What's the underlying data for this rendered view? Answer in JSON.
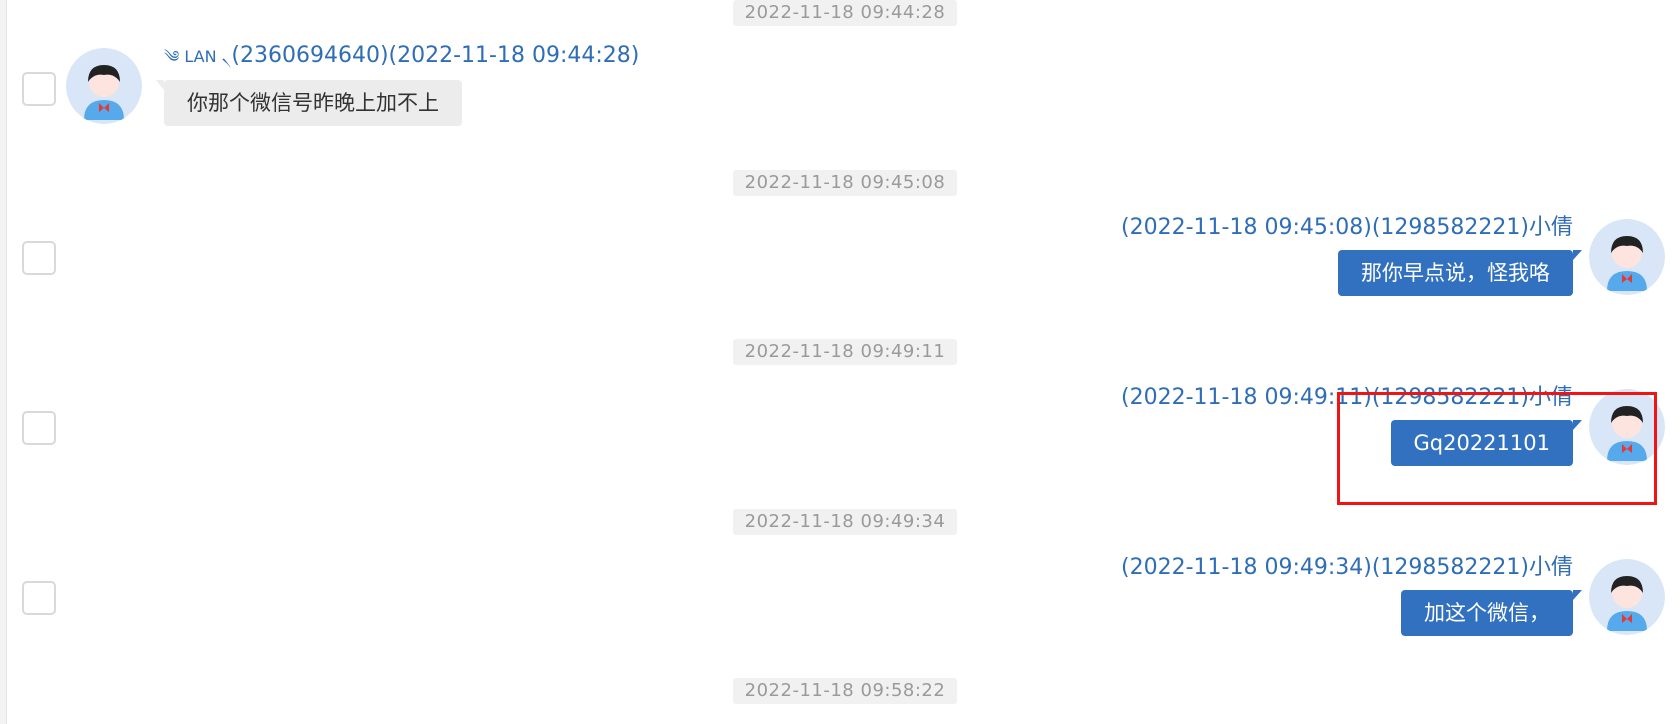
{
  "timestamps": [
    "2022-11-18 09:44:28",
    "2022-11-18 09:45:08",
    "2022-11-18 09:49:11",
    "2022-11-18 09:49:34",
    "2022-11-18 09:58:22"
  ],
  "messages": [
    {
      "direction": "incoming",
      "sender_prefix": "༄ LAN ৲",
      "header": "(2360694640)(2022-11-18 09:44:28)",
      "text": "你那个微信号昨晚上加不上"
    },
    {
      "direction": "outgoing",
      "header": "(2022-11-18 09:45:08)(1298582221)小倩",
      "text": "那你早点说，怪我咯"
    },
    {
      "direction": "outgoing",
      "header": "(2022-11-18 09:49:11)(1298582221)小倩",
      "text": "Gq20221101",
      "highlighted": true
    },
    {
      "direction": "outgoing",
      "header": "(2022-11-18 09:49:34)(1298582221)小倩",
      "text": "加这个微信，"
    }
  ],
  "colors": {
    "link_blue": "#2f6db5",
    "outgoing_bubble": "#3271bf",
    "incoming_bubble": "#ececec",
    "highlight_box": "#f01414",
    "avatar_bg": "#d8e6f7"
  },
  "icons": [
    "user-avatar-icon",
    "checkbox"
  ]
}
